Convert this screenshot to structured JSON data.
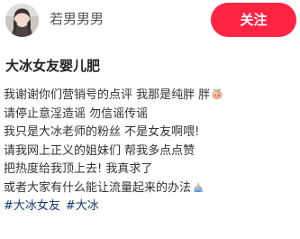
{
  "author": {
    "name": "若男男男",
    "avatar": "avatar-photo"
  },
  "follow_button": {
    "label": "关注",
    "color": "#ff2442"
  },
  "post": {
    "title": "大冰女友婴儿肥",
    "lines": [
      "我谢谢你们营销号的点评 我那是纯胖 胖",
      "请停止意淫造谣  勿信谣传谣",
      "我只是大冰老师的粉丝 不是女友啊喂!",
      "请我网上正义的姐妹们 帮我多点点赞",
      "把热度给我顶上去! 我真求了",
      "或者大家有什么能让流量起来的办法"
    ],
    "emojis": [
      "peach-emoji",
      "praying-emoji"
    ],
    "tags": [
      "#大冰女友",
      "#大冰"
    ],
    "tag_color": "#13386c"
  }
}
